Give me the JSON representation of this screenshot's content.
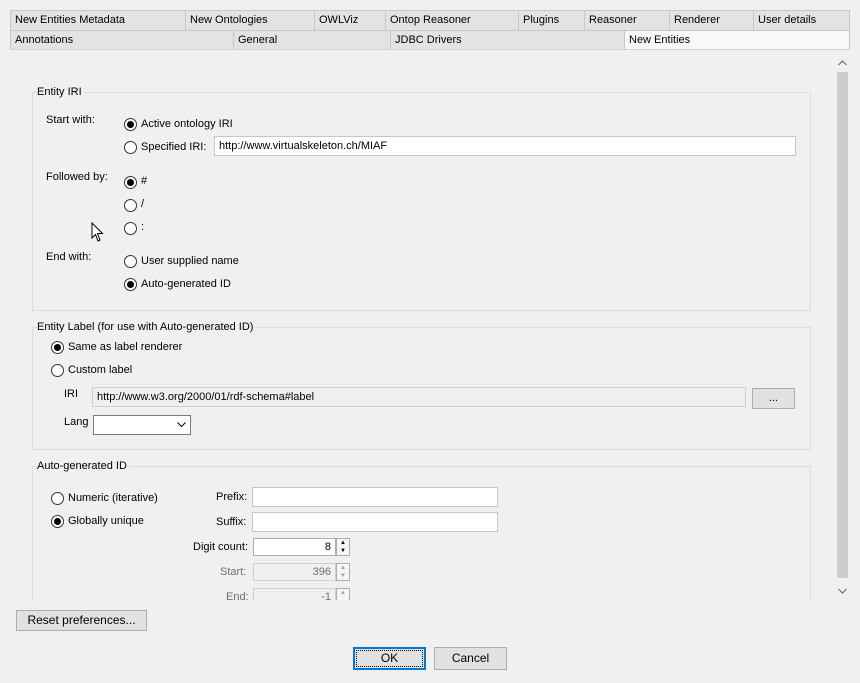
{
  "tabs_row1": [
    "New Entities Metadata",
    "New Ontologies",
    "OWLViz",
    "Ontop Reasoner",
    "Plugins",
    "Reasoner",
    "Renderer",
    "User details"
  ],
  "tabs_row2": [
    "Annotations",
    "General",
    "JDBC Drivers",
    "New Entities"
  ],
  "active_tab": "New Entities",
  "entity_iri": {
    "title": "Entity IRI",
    "start_with_label": "Start with:",
    "active_ontology_iri": "Active ontology IRI",
    "specified_iri": "Specified IRI:",
    "specified_iri_value": "http://www.virtualskeleton.ch/MIAF",
    "followed_by_label": "Followed by:",
    "followed_options": [
      "#",
      "/",
      ":"
    ],
    "end_with_label": "End with:",
    "user_supplied_name": "User supplied name",
    "auto_generated_id": "Auto-generated ID"
  },
  "entity_label": {
    "title": "Entity Label (for use with Auto-generated ID)",
    "same_as_renderer": "Same as label renderer",
    "custom_label": "Custom label",
    "iri_label": "IRI",
    "iri_value": "http://www.w3.org/2000/01/rdf-schema#label",
    "browse_button": "...",
    "lang_label": "Lang",
    "lang_value": ""
  },
  "auto_id": {
    "title": "Auto-generated ID",
    "numeric": "Numeric (iterative)",
    "globally_unique": "Globally unique",
    "prefix_label": "Prefix:",
    "prefix_value": "",
    "suffix_label": "Suffix:",
    "suffix_value": "",
    "digit_count_label": "Digit count:",
    "digit_count": "8",
    "start_label": "Start:",
    "start_value": "396",
    "end_label": "End:",
    "end_value": "-1"
  },
  "footer": {
    "reset": "Reset preferences...",
    "ok": "OK",
    "cancel": "Cancel"
  },
  "colors": {
    "accent": "#0078d7",
    "background": "#f0f0f0",
    "tab": "#e3e3e3"
  }
}
